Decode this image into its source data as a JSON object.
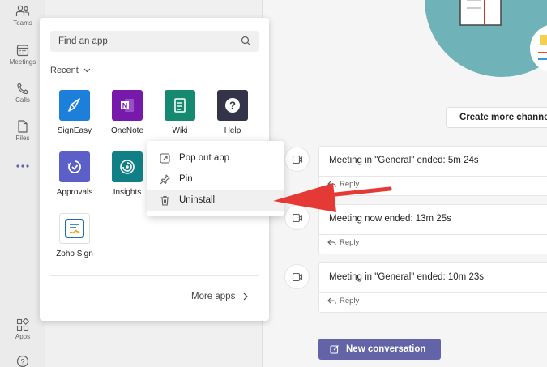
{
  "rail": {
    "items": [
      {
        "label": "Teams",
        "icon": "teams-icon"
      },
      {
        "label": "Meetings",
        "icon": "calendar-icon"
      },
      {
        "label": "Calls",
        "icon": "phone-icon"
      },
      {
        "label": "Files",
        "icon": "file-icon"
      },
      {
        "label": "",
        "icon": "more-dots-icon"
      },
      {
        "label": "Apps",
        "icon": "apps-icon"
      },
      {
        "label": "",
        "icon": "help-icon"
      }
    ]
  },
  "flyout": {
    "search_placeholder": "Find an app",
    "recent_label": "Recent",
    "apps": [
      {
        "label": "SignEasy",
        "color": "#1c7fd9"
      },
      {
        "label": "OneNote",
        "color": "#7719aa"
      },
      {
        "label": "Wiki",
        "color": "#168a70"
      },
      {
        "label": "Help",
        "color": "#33344a"
      },
      {
        "label": "Approvals",
        "color": "#5b5fc7"
      },
      {
        "label": "Insights",
        "color": "#117f86"
      },
      {
        "label": "Zoho Sign",
        "color": "#ffffff"
      }
    ],
    "more_apps_label": "More apps"
  },
  "context_menu": {
    "items": [
      {
        "label": "Pop out app",
        "icon": "pop-out-icon"
      },
      {
        "label": "Pin",
        "icon": "pin-icon"
      },
      {
        "label": "Uninstall",
        "icon": "trash-icon"
      }
    ]
  },
  "main": {
    "create_channel_label": "Create more channels",
    "meetings": [
      {
        "title": "Meeting in \"General\" ended: 5m 24s",
        "reply": "Reply"
      },
      {
        "title": "Meeting now ended: 13m 25s",
        "reply": "Reply"
      },
      {
        "title": "Meeting in \"General\" ended: 10m 23s",
        "reply": "Reply"
      }
    ],
    "new_conversation_label": "New conversation"
  },
  "colors": {
    "accent": "#6264a7",
    "annotation_arrow": "#e53935"
  }
}
